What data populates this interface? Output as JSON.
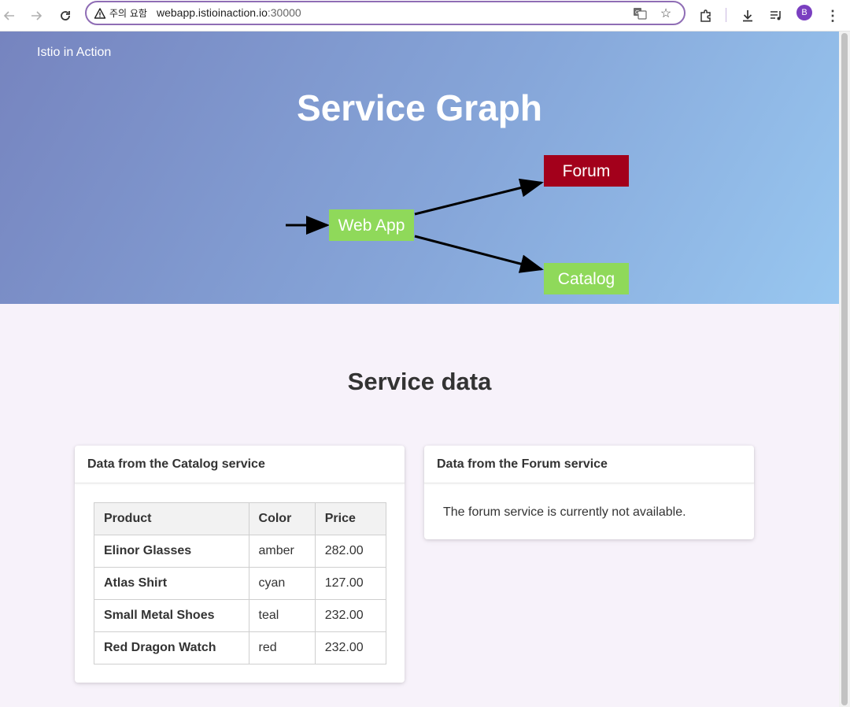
{
  "browser": {
    "security_label": "주의 요함",
    "url_host": "webapp.istioinaction.io",
    "url_port": ":30000",
    "profile_initial": "B"
  },
  "hero": {
    "brand": "Istio in Action",
    "title": "Service Graph",
    "graph": {
      "nodes": [
        {
          "label": "Web App",
          "color": "#8fd95a"
        },
        {
          "label": "Forum",
          "color": "#a3001b"
        },
        {
          "label": "Catalog",
          "color": "#8fd95a"
        }
      ]
    }
  },
  "service_data": {
    "title": "Service data",
    "catalog": {
      "header": "Data from the Catalog service",
      "columns": [
        "Product",
        "Color",
        "Price"
      ],
      "rows": [
        [
          "Elinor Glasses",
          "amber",
          "282.00"
        ],
        [
          "Atlas Shirt",
          "cyan",
          "127.00"
        ],
        [
          "Small Metal Shoes",
          "teal",
          "232.00"
        ],
        [
          "Red Dragon Watch",
          "red",
          "232.00"
        ]
      ]
    },
    "forum": {
      "header": "Data from the Forum service",
      "message": "The forum service is currently not available."
    }
  },
  "colors": {
    "hero_gradient_start": "#7684bf",
    "hero_gradient_end": "#98c7f0",
    "page_background": "#f7f2fa",
    "healthy_node": "#8fd95a",
    "failing_node": "#a3001b"
  }
}
